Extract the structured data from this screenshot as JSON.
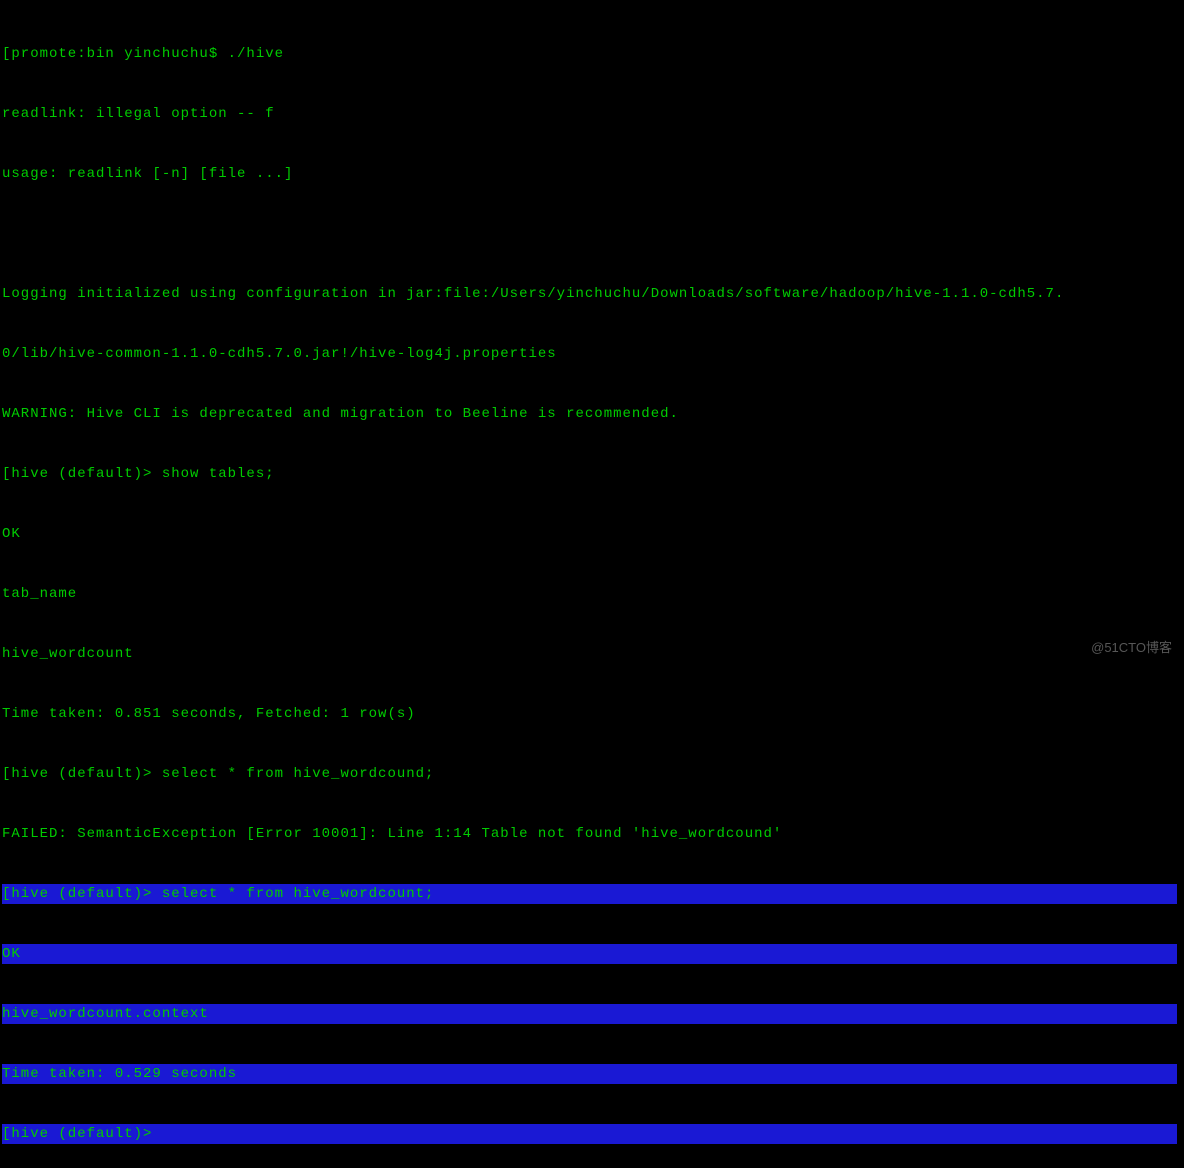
{
  "terminal": {
    "lines": [
      {
        "text": "[promote:bin yinchuchu$ ./hive",
        "highlighted": false
      },
      {
        "text": "readlink: illegal option -- f",
        "highlighted": false
      },
      {
        "text": "usage: readlink [-n] [file ...]",
        "highlighted": false
      },
      {
        "text": "",
        "highlighted": false
      },
      {
        "text": "Logging initialized using configuration in jar:file:/Users/yinchuchu/Downloads/software/hadoop/hive-1.1.0-cdh5.7.",
        "highlighted": false
      },
      {
        "text": "0/lib/hive-common-1.1.0-cdh5.7.0.jar!/hive-log4j.properties",
        "highlighted": false
      },
      {
        "text": "WARNING: Hive CLI is deprecated and migration to Beeline is recommended.",
        "highlighted": false
      },
      {
        "text": "[hive (default)> show tables;",
        "highlighted": false
      },
      {
        "text": "OK",
        "highlighted": false
      },
      {
        "text": "tab_name",
        "highlighted": false
      },
      {
        "text": "hive_wordcount",
        "highlighted": false
      },
      {
        "text": "Time taken: 0.851 seconds, Fetched: 1 row(s)",
        "highlighted": false
      },
      {
        "text": "[hive (default)> select * from hive_wordcound;",
        "highlighted": false
      },
      {
        "text": "FAILED: SemanticException [Error 10001]: Line 1:14 Table not found 'hive_wordcound'",
        "highlighted": false
      },
      {
        "text": "[hive (default)> select * from hive_wordcount;",
        "highlighted": true
      },
      {
        "text": "OK",
        "highlighted": true
      },
      {
        "text": "hive_wordcount.context",
        "highlighted": true
      },
      {
        "text": "Time taken: 0.529 seconds",
        "highlighted": true
      },
      {
        "text": "[hive (default)>",
        "highlighted": true
      }
    ]
  },
  "watermark": "@51CTO博客"
}
